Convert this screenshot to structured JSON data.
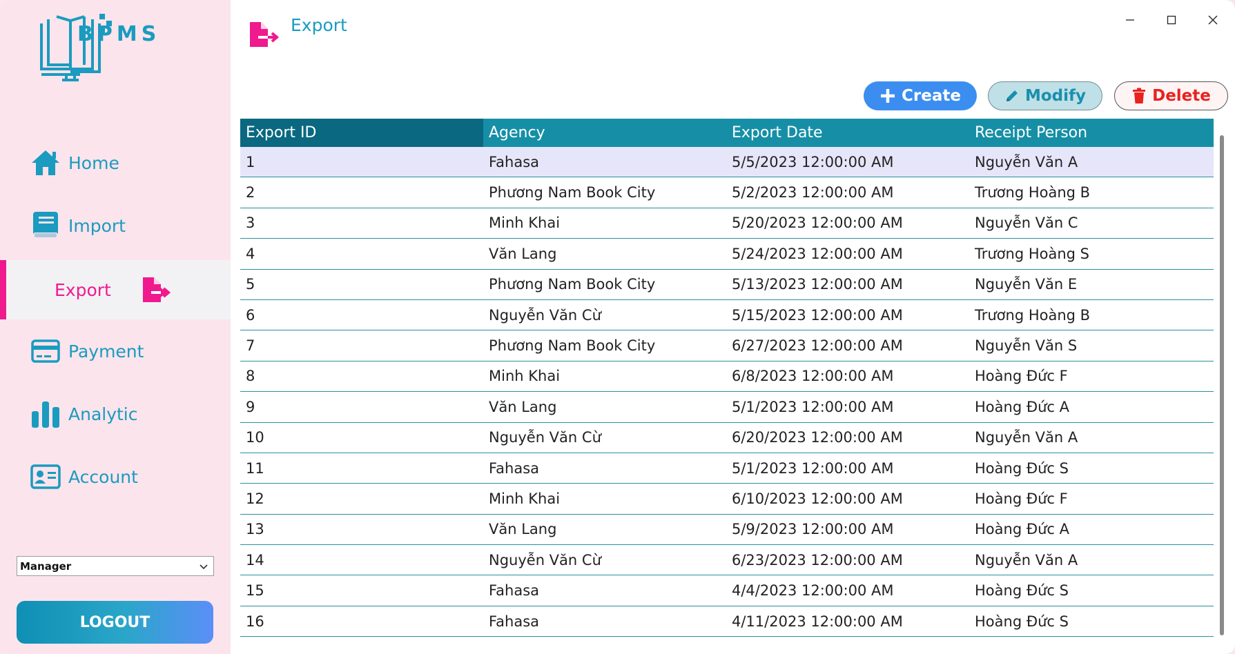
{
  "app": {
    "logo_text": "BPMS",
    "page_title": "Export"
  },
  "colors": {
    "accent": "#1a9bbf",
    "active": "#f0198e",
    "header": "#168fa6",
    "header_first": "#0a6880",
    "sidebar_bg": "#fbe4ec"
  },
  "sidebar": {
    "items": [
      {
        "label": "Home",
        "icon": "home-icon"
      },
      {
        "label": "Import",
        "icon": "book-icon"
      },
      {
        "label": "Export",
        "icon": "export-icon",
        "active": true
      },
      {
        "label": "Payment",
        "icon": "credit-card-icon"
      },
      {
        "label": "Analytic",
        "icon": "bar-chart-icon"
      },
      {
        "label": "Account",
        "icon": "id-card-icon"
      }
    ],
    "role_value": "Manager",
    "logout_label": "LOGOUT"
  },
  "toolbar": {
    "create_label": "Create",
    "modify_label": "Modify",
    "delete_label": "Delete"
  },
  "table": {
    "columns": [
      "Export ID",
      "Agency",
      "Export Date",
      "Receipt Person"
    ],
    "rows": [
      [
        "1",
        "Fahasa",
        "5/5/2023 12:00:00 AM",
        "Nguyễn Văn A"
      ],
      [
        "2",
        "Phương Nam Book City",
        "5/2/2023 12:00:00 AM",
        "Trương Hoàng B"
      ],
      [
        "3",
        "Minh Khai",
        "5/20/2023 12:00:00 AM",
        "Nguyễn Văn C"
      ],
      [
        "4",
        "Văn Lang",
        "5/24/2023 12:00:00 AM",
        "Trương Hoàng S"
      ],
      [
        "5",
        "Phương Nam Book City",
        "5/13/2023 12:00:00 AM",
        "Nguyễn Văn E"
      ],
      [
        "6",
        "Nguyễn Văn Cừ",
        "5/15/2023 12:00:00 AM",
        "Trương Hoàng B"
      ],
      [
        "7",
        "Phương Nam Book City",
        "6/27/2023 12:00:00 AM",
        "Nguyễn Văn S"
      ],
      [
        "8",
        "Minh Khai",
        "6/8/2023 12:00:00 AM",
        "Hoàng Đức F"
      ],
      [
        "9",
        "Văn Lang",
        "5/1/2023 12:00:00 AM",
        "Hoàng Đức A"
      ],
      [
        "10",
        "Nguyễn Văn Cừ",
        "6/20/2023 12:00:00 AM",
        "Nguyễn Văn A"
      ],
      [
        "11",
        "Fahasa",
        "5/1/2023 12:00:00 AM",
        "Hoàng Đức S"
      ],
      [
        "12",
        "Minh Khai",
        "6/10/2023 12:00:00 AM",
        "Hoàng Đức F"
      ],
      [
        "13",
        "Văn Lang",
        "5/9/2023 12:00:00 AM",
        "Hoàng Đức A"
      ],
      [
        "14",
        "Nguyễn Văn Cừ",
        "6/23/2023 12:00:00 AM",
        "Nguyễn Văn A"
      ],
      [
        "15",
        "Fahasa",
        "4/4/2023 12:00:00 AM",
        "Hoàng Đức S"
      ],
      [
        "16",
        "Fahasa",
        "4/11/2023 12:00:00 AM",
        "Hoàng Đức S"
      ]
    ]
  }
}
